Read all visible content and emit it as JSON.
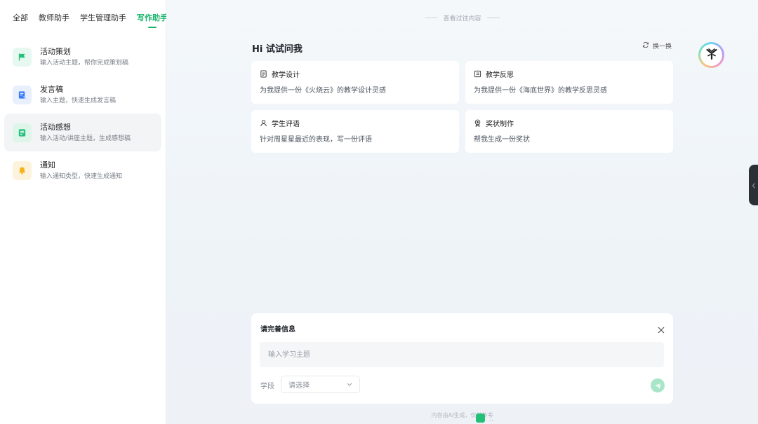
{
  "sidebar": {
    "tabs": [
      {
        "label": "全部"
      },
      {
        "label": "教师助手"
      },
      {
        "label": "学生管理助手"
      },
      {
        "label": "写作助手"
      }
    ],
    "items": [
      {
        "title": "活动策划",
        "desc": "输入活动主题，帮你完成策划稿",
        "icon": "flag-icon",
        "color": "#22c27a",
        "bg": "#e6f8ef"
      },
      {
        "title": "发言稿",
        "desc": "输入主题，快速生成发言稿",
        "icon": "document-edit-icon",
        "color": "#3b7bf6",
        "bg": "#e8f0fe"
      },
      {
        "title": "活动感想",
        "desc": "输入活动/讲座主题，生成感想稿",
        "icon": "notes-icon",
        "color": "#1fbf7c",
        "bg": "#dff5ea"
      },
      {
        "title": "通知",
        "desc": "输入通知类型，快速生成通知",
        "icon": "bell-icon",
        "color": "#f6b21b",
        "bg": "#fdf3dc"
      }
    ]
  },
  "main": {
    "history_link": "查看过往内容",
    "greeting": "Hi 试试问我",
    "refresh_label": "换一换",
    "cards": [
      {
        "title": "教学设计",
        "desc": "为我提供一份《火烧云》的教学设计灵感",
        "icon": "lesson-doc-icon"
      },
      {
        "title": "教学反思",
        "desc": "为我提供一份《海底世界》的教学反思灵感",
        "icon": "reflection-icon"
      },
      {
        "title": "学生评语",
        "desc": "针对周星星最近的表现，写一份评语",
        "icon": "student-icon"
      },
      {
        "title": "奖状制作",
        "desc": "帮我生成一份奖状",
        "icon": "award-icon"
      }
    ]
  },
  "form": {
    "title": "请完善信息",
    "topic_placeholder": "输入学习主题",
    "topic_value": "",
    "stage_label": "学段",
    "stage_placeholder": "请选择"
  },
  "footer": {
    "note": "内容由AI生成，仅供参考"
  },
  "colors": {
    "accent": "#18b56c",
    "send_button": "#a9e6c9"
  }
}
